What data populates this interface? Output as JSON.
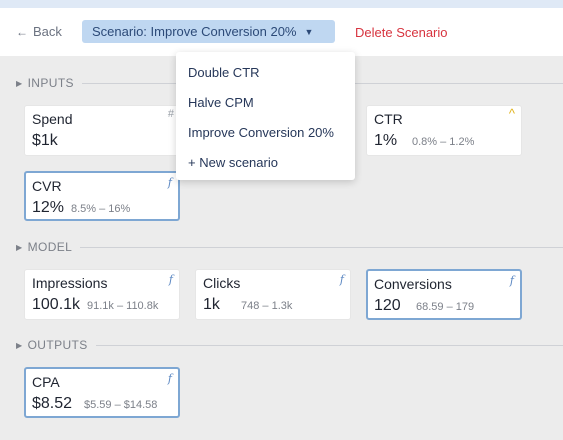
{
  "toolbar": {
    "back_label": "Back",
    "scenario_label": "Scenario: Improve Conversion 20%",
    "delete_label": "Delete Scenario"
  },
  "dropdown": {
    "items": [
      "Double CTR",
      "Halve CPM",
      "Improve Conversion 20%",
      "+ New scenario"
    ]
  },
  "sections": {
    "inputs": "INPUTS",
    "model": "MODEL",
    "outputs": "OUTPUTS"
  },
  "cards": {
    "spend": {
      "name": "Spend",
      "value": "$1k",
      "icon": "hash-icon"
    },
    "ctr": {
      "name": "CTR",
      "value": "1%",
      "range": "0.8% – 1.2%",
      "icon": "caret-up-icon"
    },
    "cvr": {
      "name": "CVR",
      "value": "12%",
      "range": "8.5% – 16%",
      "icon": "function-icon"
    },
    "impressions": {
      "name": "Impressions",
      "value": "100.1k",
      "range": "91.1k – 110.8k",
      "icon": "function-icon"
    },
    "clicks": {
      "name": "Clicks",
      "value": "1k",
      "range": "748 – 1.3k",
      "icon": "function-icon"
    },
    "conversions": {
      "name": "Conversions",
      "value": "120",
      "range": "68.59 – 179",
      "icon": "function-icon"
    },
    "cpa": {
      "name": "CPA",
      "value": "$8.52",
      "range": "$5.59 – $14.58",
      "icon": "function-icon"
    }
  },
  "colors": {
    "accent": "#bfd7f1",
    "danger": "#d7343f",
    "selected_border": "#7ea7d3"
  }
}
